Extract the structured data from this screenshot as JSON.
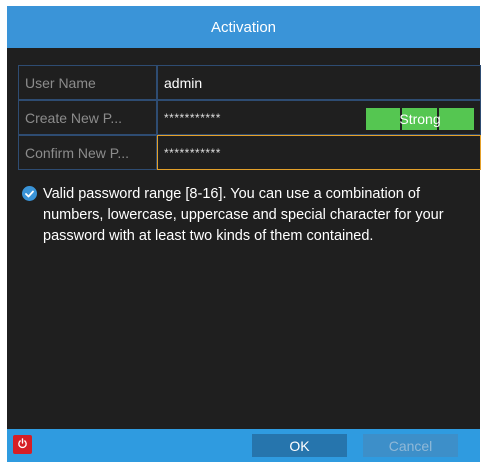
{
  "dialog": {
    "title": "Activation"
  },
  "form": {
    "rows": [
      {
        "label": "User Name",
        "value": "admin"
      },
      {
        "label": "Create New P...",
        "value": "***********"
      },
      {
        "label": "Confirm New P...",
        "value": "***********"
      }
    ],
    "strength_label": "Strong"
  },
  "hint": {
    "text": "Valid password range [8-16]. You can use a combination of numbers, lowercase, uppercase and special character for your password with at least two kinds of them contained."
  },
  "footer": {
    "ok_label": "OK",
    "cancel_label": "Cancel"
  },
  "colors": {
    "title_bar": "#3a94d8",
    "body": "#1f1f1f",
    "strength": "#55c651",
    "focus_border": "#e4a02a",
    "power": "#d61f26"
  },
  "icons": {
    "hint": "check-circle-icon",
    "power": "power-icon"
  }
}
